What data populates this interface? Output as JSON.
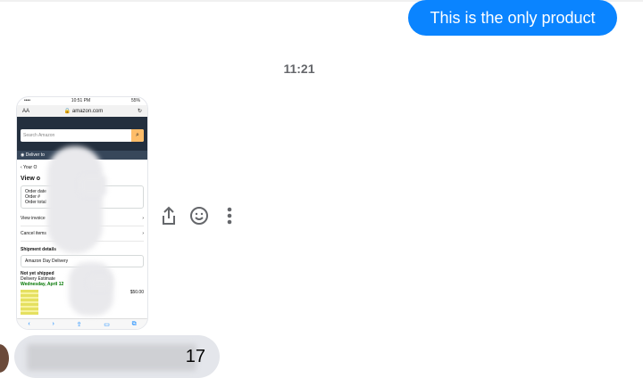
{
  "outgoing_message": {
    "text": "This is the only product",
    "color": "#0a84ff"
  },
  "timestamp": "11:21",
  "screenshot_attachment": {
    "status_time": "10:51 PM",
    "status_battery": "55%",
    "url_left": "AA",
    "url": "amazon.com",
    "search_placeholder": "Search Amazon",
    "deliver_to": "Deliver to",
    "breadcrumb": "Your O",
    "heading": "View o",
    "order_info": [
      "Order date",
      "Order #",
      "Order total"
    ],
    "links": [
      "View invoice",
      "Cancel items"
    ],
    "shipment_details": "Shipment details",
    "delivery_type": "Amazon Day Delivery",
    "not_shipped": "Not yet shipped",
    "delivery_estimate": "Delivery Estimate",
    "delivery_date": "Wednesday, April 12",
    "price": "$50.00"
  },
  "actions": [
    "share-icon",
    "emoji-icon",
    "more-icon"
  ],
  "incoming_message": {
    "text_suffix": "17",
    "color": "#e4e6eb"
  }
}
